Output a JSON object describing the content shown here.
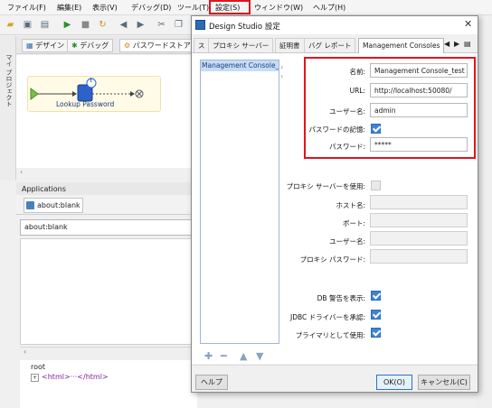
{
  "menubar": {
    "items": [
      "ファイル(F)",
      "編集(E)",
      "表示(V)",
      "デバッグ(D)",
      "ツール(T)",
      "設定(S)",
      "ウィンドウ(W)",
      "ヘルプ(H)"
    ]
  },
  "left_strip": {
    "label": "マイ プロジェクト"
  },
  "editor": {
    "tabs": [
      "デザイン",
      "デバッグ",
      "パスワードストア"
    ],
    "flow_step_label": "Lookup Password",
    "flow_badge": "!"
  },
  "applications": {
    "title": "Applications",
    "tab_label": "about:blank",
    "url": "about:blank",
    "tree_root": "root",
    "tree_child": "<html>···</html>"
  },
  "dialog": {
    "title": "Design Studio 設定",
    "close": "✕",
    "tabs": [
      "ス",
      "プロキシ サーバー",
      "証明書",
      "バグ レポート",
      "Management Consoles"
    ],
    "active_tab": "Management Consoles",
    "tab_nav": [
      "◀",
      "▶",
      "▤"
    ],
    "list": {
      "selected": "Management Console_test",
      "collapse": "‹",
      "expand": "›",
      "add": "✚",
      "remove": "━",
      "up": "▲",
      "down": "▼"
    },
    "form": {
      "name_label": "名前:",
      "name_value": "Management Console_test",
      "url_label": "URL:",
      "url_value": "http://localhost:50080/",
      "user_label": "ユーザー名:",
      "user_value": "admin",
      "remember_label": "パスワードの記憶:",
      "remember_checked": true,
      "password_label": "パスワード:",
      "password_value": "*****",
      "proxy_use_label": "プロキシ サーバーを使用:",
      "proxy_use_checked": false,
      "host_label": "ホスト名:",
      "port_label": "ポート:",
      "proxy_user_label": "ユーザー名:",
      "proxy_password_label": "プロキシ パスワード:",
      "db_warning_label": "DB 警告を表示:",
      "db_warning_checked": true,
      "jdbc_label": "JDBC ドライバーを承認:",
      "jdbc_checked": true,
      "primary_label": "プライマリとして使用:",
      "primary_checked": true
    },
    "buttons": {
      "help": "ヘルプ",
      "ok": "OK(O)",
      "cancel": "キャンセル(C)"
    }
  },
  "colors": {
    "highlight": "#e0141e",
    "selection": "#c7dcf5",
    "checkbox": "#3e83d4"
  }
}
